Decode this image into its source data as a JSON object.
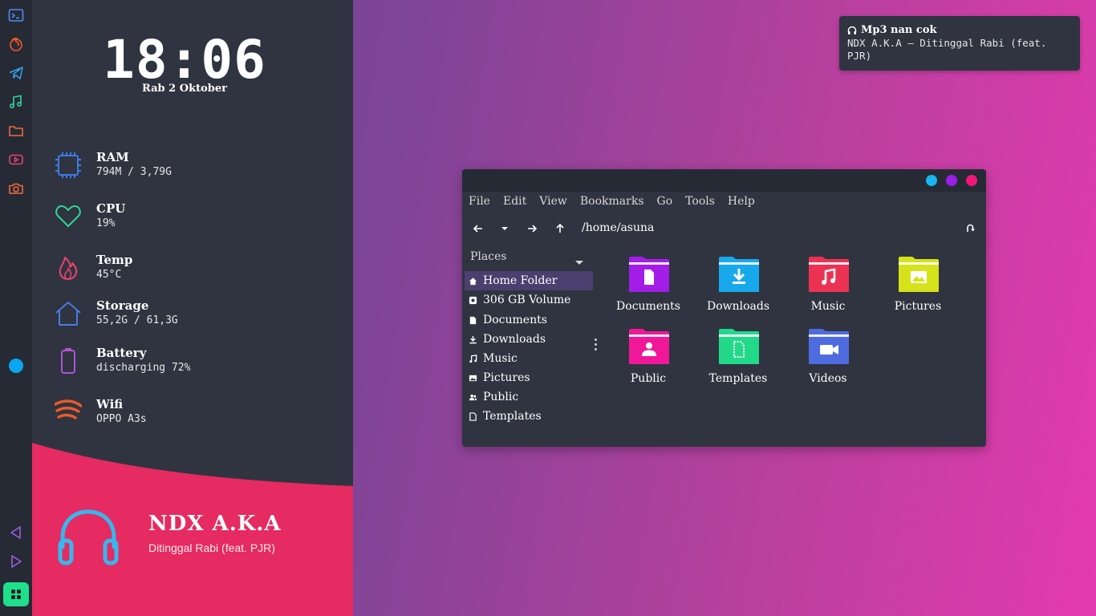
{
  "colors": {
    "dock_bg": "#262a35",
    "panel_bg": "#2f3440",
    "accent_pink": "#e52b61",
    "accent_blue": "#36b7ee",
    "dock_dot": "#0aa6f0",
    "apps_button": "#1fe08a"
  },
  "dock": {
    "icons": [
      "terminal-icon",
      "firefox-icon",
      "telegram-icon",
      "music-note-icon",
      "folder-icon",
      "youtube-icon",
      "camera-icon"
    ],
    "bottom_icons": [
      "previous-icon",
      "play-icon",
      "apps-grid-icon"
    ]
  },
  "clock": {
    "time": "18:06",
    "date": "Rab 2 Oktober"
  },
  "stats": [
    {
      "label": "RAM",
      "value": "794M / 3,79G",
      "icon": "chip-icon",
      "color": "#3b7be8"
    },
    {
      "label": "CPU",
      "value": "19%",
      "icon": "heart-icon",
      "color": "#2ed59a"
    },
    {
      "label": "Temp",
      "value": "45°C",
      "icon": "flame-icon",
      "color": "#e8436f"
    },
    {
      "label": "Storage",
      "value": "55,2G / 61,3G",
      "icon": "home-icon",
      "color": "#4a7ae0"
    },
    {
      "label": "Battery",
      "value": "discharging 72%",
      "icon": "battery-icon",
      "color": "#b153d4"
    },
    {
      "label": "Wifi",
      "value": "OPPO A3s",
      "icon": "wifi-icon",
      "color": "#e85a2a"
    }
  ],
  "music": {
    "artist": "NDX A.K.A",
    "track": "Ditinggal Rabi (feat. PJR)"
  },
  "notification": {
    "title": "Mp3 nan cok",
    "body": "NDX A.K.A – Ditinggal Rabi (feat. PJR)"
  },
  "file_manager": {
    "titlebar_buttons": [
      "#17b6ee",
      "#9b1ee6",
      "#f0157a"
    ],
    "menu": [
      "File",
      "Edit",
      "View",
      "Bookmarks",
      "Go",
      "Tools",
      "Help"
    ],
    "path": "/home/asuna",
    "places_label": "Places",
    "places": [
      {
        "label": "Home Folder",
        "icon": "home-icon",
        "selected": true
      },
      {
        "label": "306 GB Volume",
        "icon": "drive-icon",
        "selected": false
      },
      {
        "label": "Documents",
        "icon": "document-icon",
        "selected": false
      },
      {
        "label": "Downloads",
        "icon": "download-icon",
        "selected": false
      },
      {
        "label": "Music",
        "icon": "music-note-icon",
        "selected": false
      },
      {
        "label": "Pictures",
        "icon": "image-icon",
        "selected": false
      },
      {
        "label": "Public",
        "icon": "people-icon",
        "selected": false
      },
      {
        "label": "Templates",
        "icon": "document-icon",
        "selected": false
      }
    ],
    "folders": [
      {
        "name": "Documents",
        "color": "#a21ee8",
        "glyph": "document"
      },
      {
        "name": "Downloads",
        "color": "#17a9ec",
        "glyph": "download"
      },
      {
        "name": "Music",
        "color": "#ec3253",
        "glyph": "music"
      },
      {
        "name": "Pictures",
        "color": "#d6e21a",
        "glyph": "picture"
      },
      {
        "name": "Public",
        "color": "#f01898",
        "glyph": "person"
      },
      {
        "name": "Templates",
        "color": "#22d98a",
        "glyph": "template"
      },
      {
        "name": "Videos",
        "color": "#4f6be0",
        "glyph": "video"
      }
    ]
  }
}
